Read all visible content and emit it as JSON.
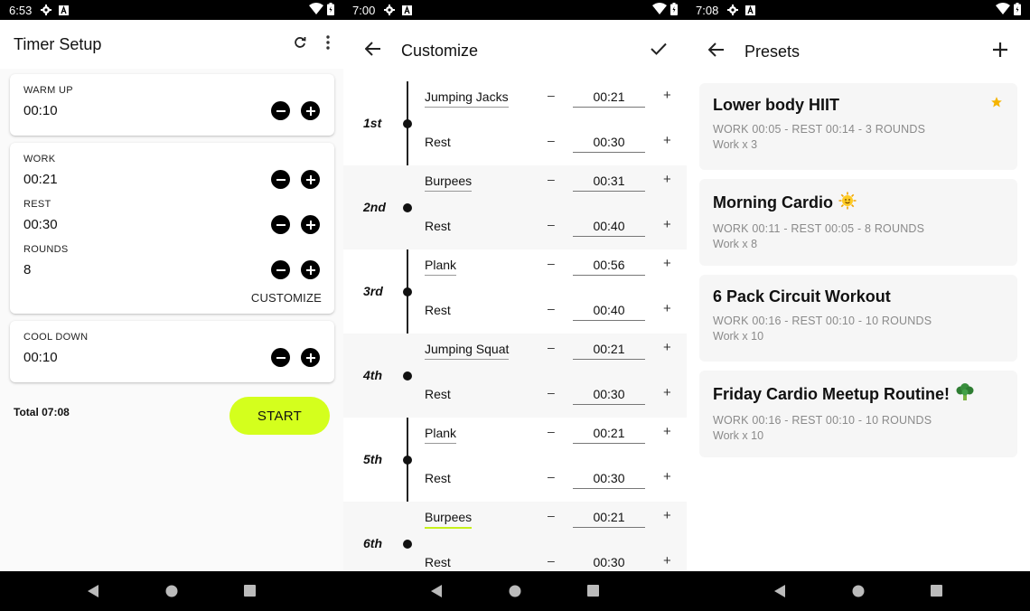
{
  "screen1": {
    "status": {
      "time": "6:53"
    },
    "title": "Timer Setup",
    "warmup": {
      "label": "WARM UP",
      "value": "00:10"
    },
    "work": {
      "label": "WORK",
      "value": "00:21"
    },
    "rest": {
      "label": "REST",
      "value": "00:30"
    },
    "rounds": {
      "label": "ROUNDS",
      "value": "8"
    },
    "customize_label": "CUSTOMIZE",
    "cooldown": {
      "label": "COOL DOWN",
      "value": "00:10"
    },
    "total": "Total 07:08",
    "start_label": "START"
  },
  "screen2": {
    "status": {
      "time": "7:00"
    },
    "title": "Customize",
    "rounds": [
      {
        "label": "1st",
        "exercise": "Jumping Jacks",
        "ex_time": "00:21",
        "rest": "Rest",
        "rest_time": "00:30"
      },
      {
        "label": "2nd",
        "exercise": "Burpees",
        "ex_time": "00:31",
        "rest": "Rest",
        "rest_time": "00:40"
      },
      {
        "label": "3rd",
        "exercise": "Plank",
        "ex_time": "00:56",
        "rest": "Rest",
        "rest_time": "00:40"
      },
      {
        "label": "4th",
        "exercise": "Jumping Squat",
        "ex_time": "00:21",
        "rest": "Rest",
        "rest_time": "00:30"
      },
      {
        "label": "5th",
        "exercise": "Plank",
        "ex_time": "00:21",
        "rest": "Rest",
        "rest_time": "00:30"
      },
      {
        "label": "6th",
        "exercise": "Burpees",
        "ex_time": "00:21",
        "rest": "Rest",
        "rest_time": "00:30"
      }
    ],
    "minus": "–",
    "plus": "+"
  },
  "screen3": {
    "status": {
      "time": "7:08"
    },
    "title": "Presets",
    "presets": [
      {
        "title": "Lower body HIIT",
        "summary": "WORK 00:05 - REST 00:14 - 3 ROUNDS",
        "work": "Work x 3"
      },
      {
        "title": "Morning Cardio",
        "summary": "WORK 00:11 - REST 00:05 - 8 ROUNDS",
        "work": "Work x 8"
      },
      {
        "title": "6 Pack Circuit Workout",
        "summary": "WORK 00:16 - REST 00:10 - 10 ROUNDS",
        "work": "Work x 10"
      },
      {
        "title": "Friday Cardio Meetup Routine!",
        "summary": "WORK 00:16 - REST 00:10 - 10 ROUNDS",
        "work": "Work x 10"
      }
    ]
  },
  "colors": {
    "accent": "#d4ff1d",
    "star": "#f5b400",
    "card_bg": "#f6f6f6"
  },
  "icons": [
    "wifi-icon",
    "battery-icon",
    "gear-icon",
    "a-notification-icon",
    "refresh-icon",
    "more-vert-icon",
    "minus-circle-icon",
    "plus-circle-icon",
    "back-arrow-icon",
    "check-icon",
    "add-icon",
    "star-icon",
    "sun-emoji-icon",
    "broccoli-emoji-icon",
    "nav-back-icon",
    "nav-home-icon",
    "nav-recents-icon"
  ]
}
